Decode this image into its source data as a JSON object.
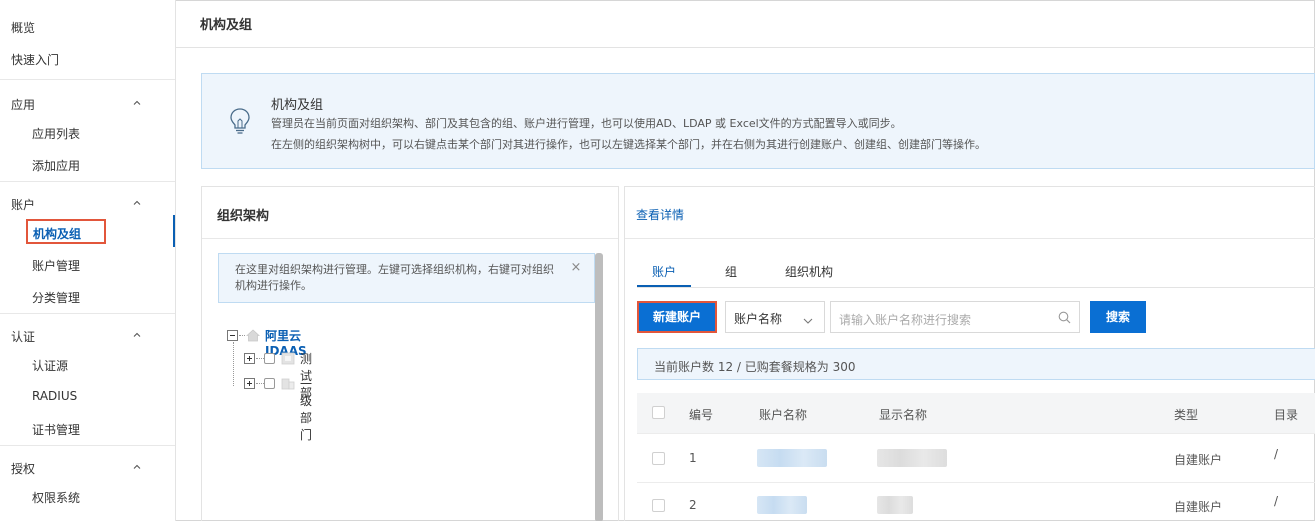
{
  "sidebar": {
    "overview": "概览",
    "quickstart": "快速入门",
    "groups": [
      {
        "label": "应用",
        "items": [
          "应用列表",
          "添加应用"
        ]
      },
      {
        "label": "账户",
        "items": [
          "机构及组",
          "账户管理",
          "分类管理"
        ]
      },
      {
        "label": "认证",
        "items": [
          "认证源",
          "RADIUS",
          "证书管理"
        ]
      },
      {
        "label": "授权",
        "items": [
          "权限系统"
        ]
      }
    ],
    "active_item": "机构及组"
  },
  "header": {
    "title": "机构及组"
  },
  "banner": {
    "icon": "lightbulb-icon",
    "title": "机构及组",
    "line1": "管理员在当前页面对组织架构、部门及其包含的组、账户进行管理，也可以使用AD、LDAP 或 Excel文件的方式配置导入或同步。",
    "line2": "在左侧的组织架构树中，可以右键点击某个部门对其进行操作，也可以左键选择某个部门，并在右侧为其进行创建账户、创建组、创建部门等操作。"
  },
  "org_panel": {
    "title": "组织架构",
    "tip": "在这里对组织架构进行管理。左键可选择组织机构，右键可对组织机构进行操作。",
    "tip_close": "×",
    "tree": {
      "root": "阿里云IDAAS",
      "children": [
        "测试部",
        "一级部门"
      ]
    }
  },
  "detail_panel": {
    "link": "查看详情",
    "tabs": [
      "账户",
      "组",
      "组织机构"
    ],
    "active_tab": "账户",
    "new_button": "新建账户",
    "filter_select": "账户名称",
    "search_placeholder": "请输入账户名称进行搜索",
    "search_button": "搜索",
    "quota_text": "当前账户数 12 / 已购套餐规格为 300",
    "columns": [
      "编号",
      "账户名称",
      "显示名称",
      "类型",
      "目录"
    ],
    "rows": [
      {
        "no": "1",
        "type": "自建账户",
        "dir": "/"
      },
      {
        "no": "2",
        "type": "自建账户",
        "dir": "/"
      }
    ]
  },
  "colors": {
    "primary": "#0a6fd3",
    "link": "#0a5fb3",
    "highlight": "#e2563b",
    "info_bg": "#eef5fc"
  }
}
